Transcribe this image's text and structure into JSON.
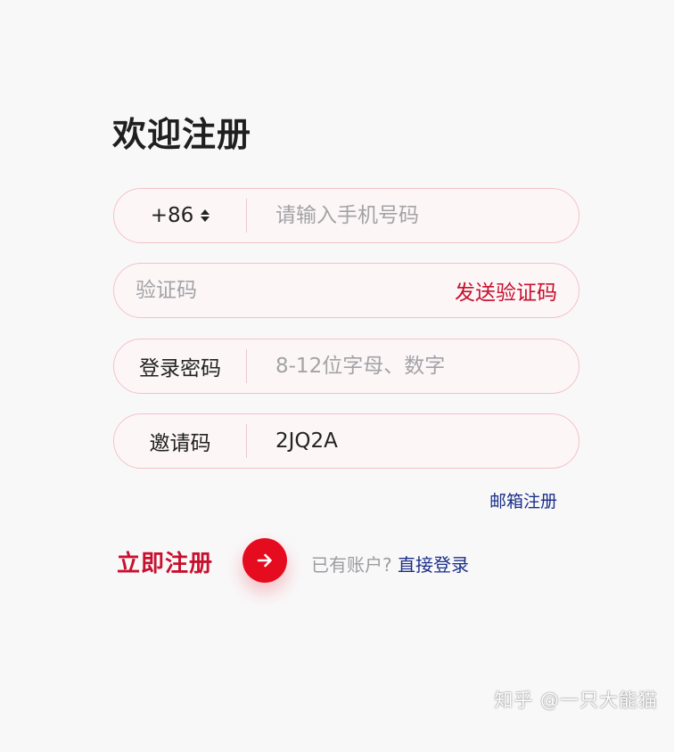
{
  "title": "欢迎注册",
  "form": {
    "phone": {
      "country_code": "+86",
      "placeholder": "请输入手机号码",
      "value": ""
    },
    "sms_code": {
      "placeholder": "验证码",
      "value": "",
      "send_label": "发送验证码"
    },
    "password": {
      "label": "登录密码",
      "placeholder": "8-12位字母、数字",
      "value": ""
    },
    "invite_code": {
      "label": "邀请码",
      "value": "2JQ2A"
    }
  },
  "email_register_link": "邮箱注册",
  "register": {
    "label": "立即注册",
    "icon": "arrow-right-icon"
  },
  "login_hint": {
    "text": "已有账户?",
    "link": "直接登录"
  },
  "watermark": "知乎 @一只大能猫",
  "colors": {
    "accent": "#e60c1f",
    "accent_text": "#c8102e",
    "link": "#1a2f8a",
    "field_border": "#f3c2ca"
  }
}
